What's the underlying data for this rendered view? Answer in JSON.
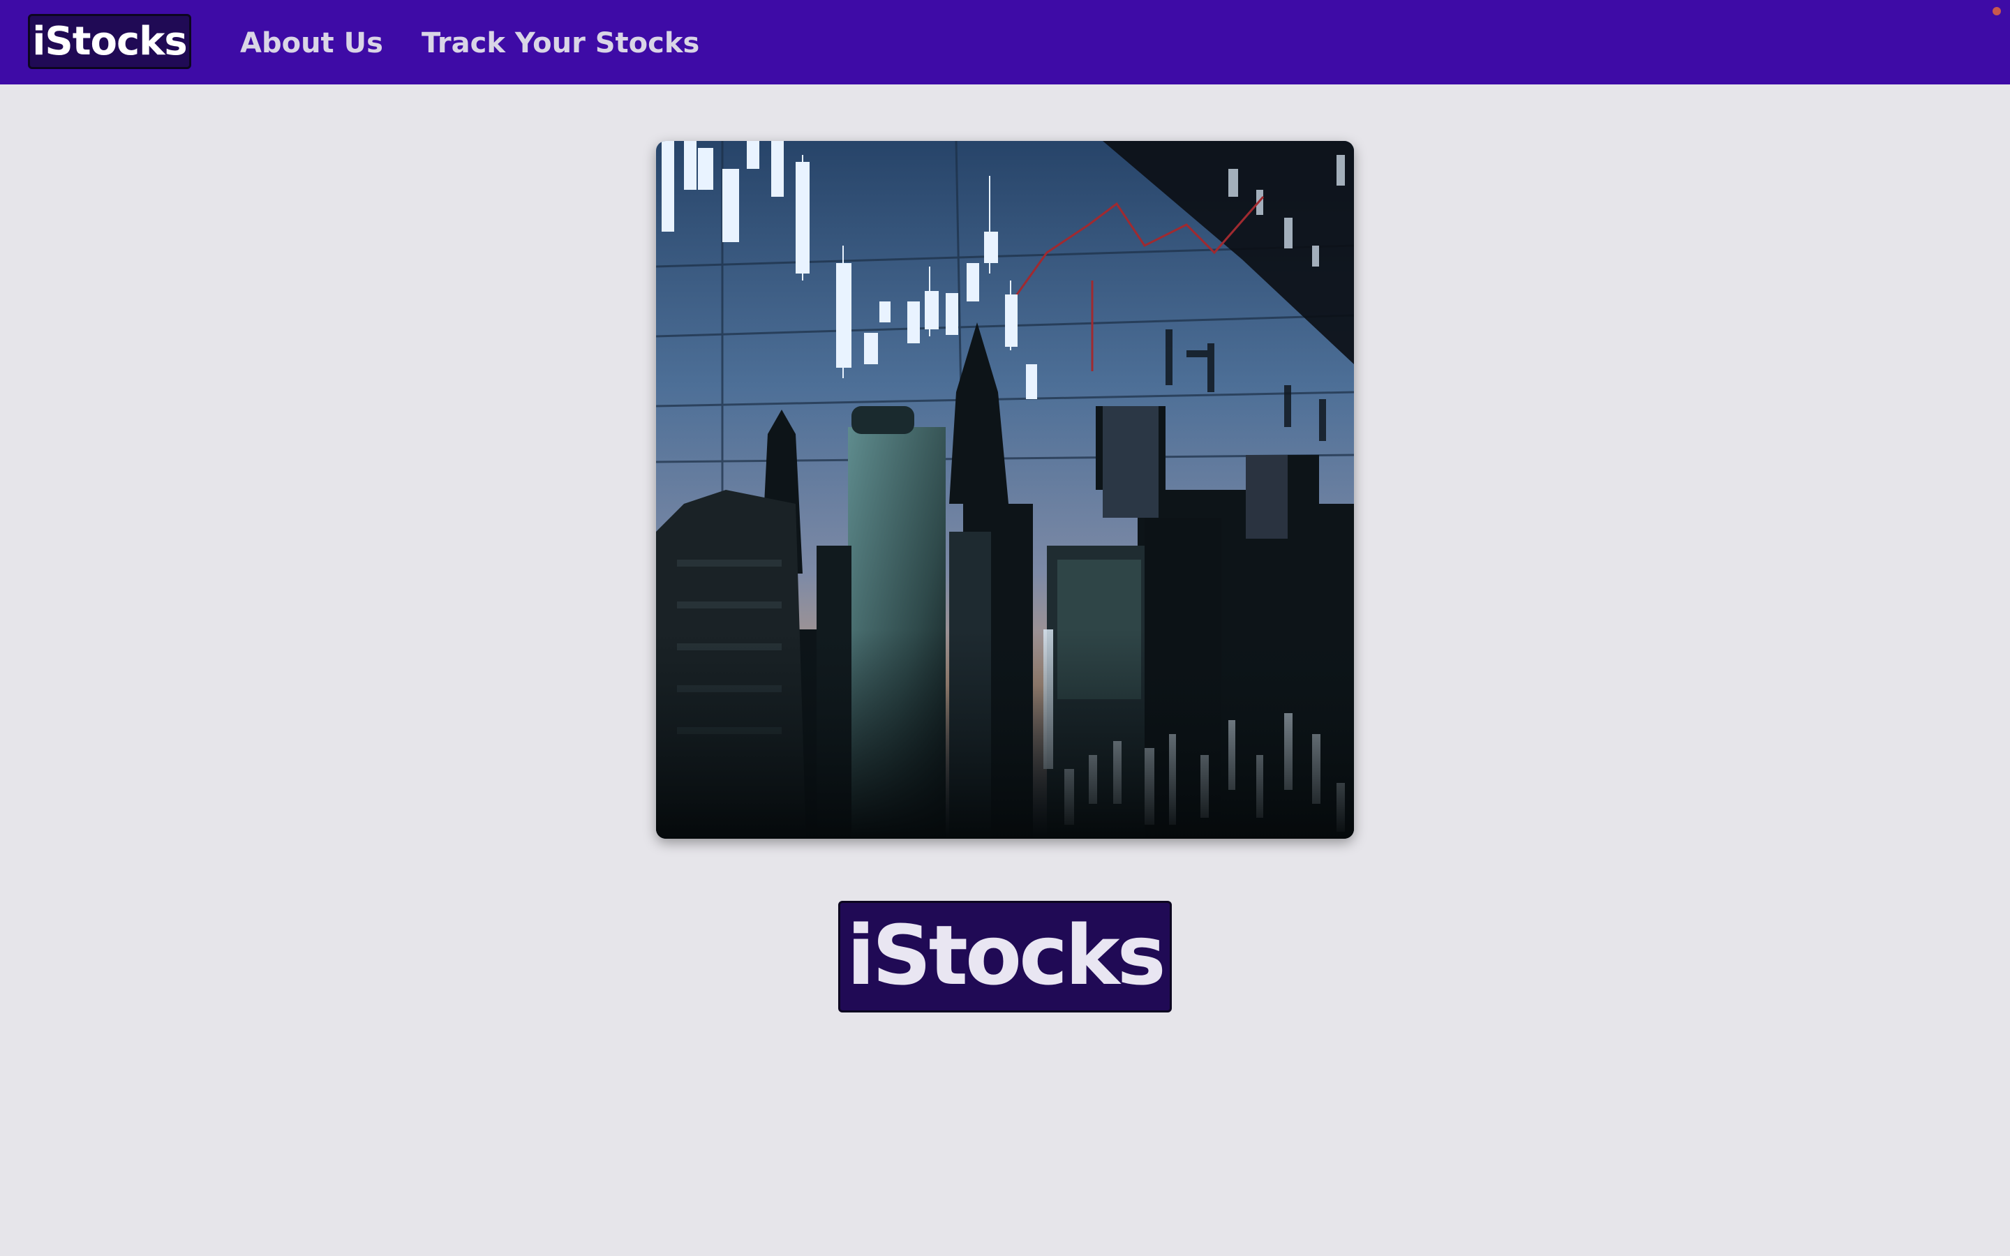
{
  "navbar": {
    "brand": "iStocks",
    "links": [
      {
        "label": "About Us"
      },
      {
        "label": "Track Your Stocks"
      }
    ]
  },
  "hero": {
    "title": "iStocks",
    "image_icon": "city-skyline-stock-chart-image"
  },
  "colors": {
    "navbar_bg": "#3e0ba6",
    "brand_bg": "#200a55",
    "page_bg": "#e6e5ea"
  }
}
